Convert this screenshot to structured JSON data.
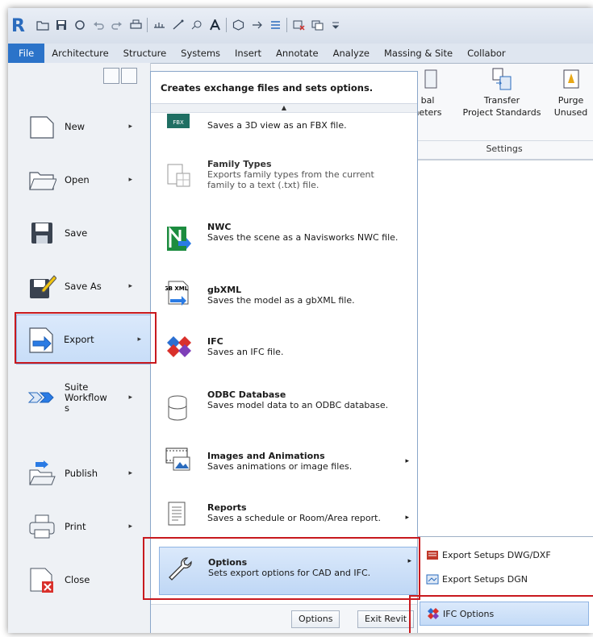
{
  "title_bar": {
    "logo": "R"
  },
  "tabs": [
    "File",
    "Architecture",
    "Structure",
    "Systems",
    "Insert",
    "Annotate",
    "Analyze",
    "Massing & Site",
    "Collabor"
  ],
  "ribbon": {
    "buttons": [
      {
        "label_1": "bal",
        "label_2": "neters"
      },
      {
        "label_1": "Transfer",
        "label_2": "Project Standards"
      },
      {
        "label_1": "Purge",
        "label_2": "Unused"
      }
    ],
    "group_label": "Settings"
  },
  "file_menu": {
    "items": [
      {
        "label": "New",
        "has_arrow": true
      },
      {
        "label": "Open",
        "has_arrow": true
      },
      {
        "label": "Save",
        "has_arrow": false
      },
      {
        "label": "Save As",
        "has_arrow": true
      },
      {
        "label": "Export",
        "has_arrow": true
      },
      {
        "label": "Suite Workflows",
        "label_l1": "Suite",
        "label_l2": "Workflow",
        "label_l3": "s",
        "has_arrow": true
      },
      {
        "label": "Publish",
        "has_arrow": true
      },
      {
        "label": "Print",
        "has_arrow": true
      },
      {
        "label": "Close",
        "has_arrow": false
      }
    ],
    "arrow": "▸"
  },
  "export_menu": {
    "header": "Creates exchange files and sets options.",
    "scroll_up": "▲",
    "items": [
      {
        "title": "",
        "desc": "Saves a 3D view as an FBX file.",
        "icon": "fbx-icon",
        "badge": "FBX"
      },
      {
        "title": "Family Types",
        "desc": "Exports family types from the current family to a text (.txt) file.",
        "icon": "family-types-icon"
      },
      {
        "title": "NWC",
        "desc": "Saves the scene as a Navisworks NWC file.",
        "icon": "navisworks-icon"
      },
      {
        "title": "gbXML",
        "desc": "Saves the model as a gbXML file.",
        "icon": "gbxml-icon",
        "badge": "GB XML"
      },
      {
        "title": "IFC",
        "desc": "Saves an IFC file.",
        "icon": "ifc-icon"
      },
      {
        "title": "ODBC Database",
        "desc": "Saves model data to an ODBC database.",
        "icon": "database-icon"
      },
      {
        "title": "Images and Animations",
        "desc": "Saves animations or image files.",
        "icon": "film-icon",
        "has_arrow": true
      },
      {
        "title": "Reports",
        "desc": "Saves a schedule or Room/Area report.",
        "icon": "report-icon",
        "has_arrow": true
      },
      {
        "title": "Options",
        "desc": "Sets export options for CAD and IFC.",
        "icon": "wrench-icon",
        "has_arrow": true
      }
    ],
    "footer": {
      "options_button": "Options",
      "exit_button": "Exit Revit"
    }
  },
  "options_flyout": {
    "items": [
      {
        "label": "Export Setups DWG/DXF",
        "icon": "dwg-setup-icon"
      },
      {
        "label": "Export Setups DGN",
        "icon": "dgn-setup-icon"
      },
      {
        "label": "IFC Options",
        "icon": "ifc-options-icon"
      }
    ]
  },
  "colors": {
    "accent": "#2b73c9",
    "highlight_border": "#c8191e",
    "selection": "#c7ddf8"
  }
}
